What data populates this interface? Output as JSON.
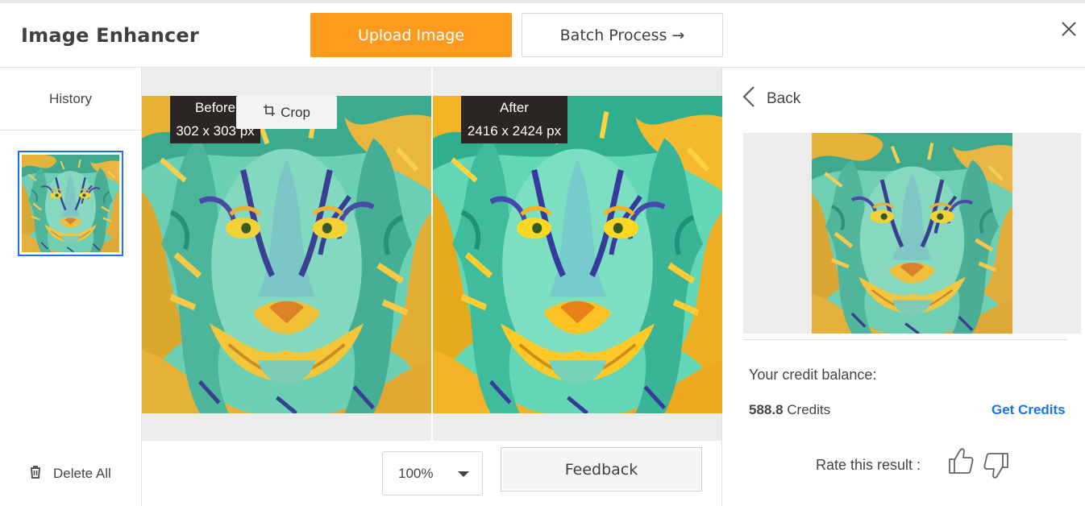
{
  "header": {
    "app_title": "Image Enhancer",
    "upload_label": "Upload Image",
    "batch_label": "Batch Process →",
    "accent_color": "#fd9b1e"
  },
  "sidebar": {
    "history_label": "History",
    "delete_all_label": "Delete All",
    "selected_border_color": "#1a73e8"
  },
  "compare": {
    "before_title": "Before",
    "before_size": "302 x 303 px",
    "after_title": "After",
    "after_size": "2416 x 2424 px",
    "crop_label": "Crop"
  },
  "controls": {
    "zoom_value": "100%",
    "feedback_label": "Feedback"
  },
  "right_panel": {
    "back_label": "Back",
    "credit_title": "Your credit balance:",
    "credit_amount": "588.8",
    "credit_unit": " Credits",
    "get_credits_label": "Get Credits",
    "rate_label": "Rate this result :",
    "link_color": "#1a73e8"
  },
  "icons": [
    "close-icon",
    "trash-icon",
    "crop-icon",
    "chevron-down-icon",
    "back-chevron-icon",
    "thumbs-up-icon",
    "thumbs-down-icon"
  ]
}
